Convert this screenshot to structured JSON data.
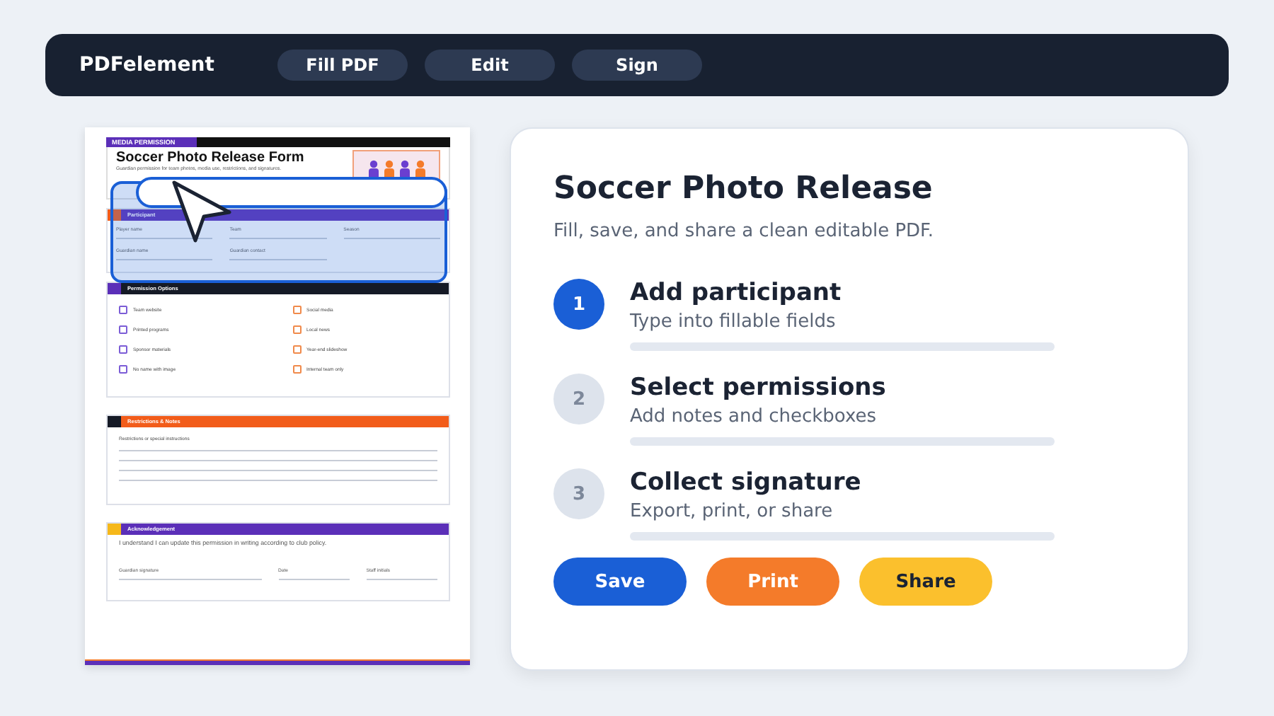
{
  "top_bar": {
    "brand": "PDFelement",
    "nav": [
      "Fill PDF",
      "Edit",
      "Sign"
    ]
  },
  "document": {
    "tag": "MEDIA PERMISSION",
    "title": "Soccer Photo Release Form",
    "subtitle": "Guardian permission for team photos, media use, restrictions, and signatures.",
    "participant": {
      "header": "Participant",
      "fields": [
        {
          "label": "Player name"
        },
        {
          "label": "Team"
        },
        {
          "label": "Season"
        },
        {
          "label": "Guardian name"
        },
        {
          "label": "Guardian contact"
        }
      ]
    },
    "permissions": {
      "header": "Permission Options",
      "options": [
        {
          "label": "Team website",
          "color": "#7b5cd6",
          "checked": false
        },
        {
          "label": "Social media",
          "color": "#f08a4b",
          "checked": false
        },
        {
          "label": "Printed programs",
          "color": "#7b5cd6",
          "checked": false
        },
        {
          "label": "Local news",
          "color": "#f08a4b",
          "checked": false
        },
        {
          "label": "Sponsor materials",
          "color": "#7b5cd6",
          "checked": false
        },
        {
          "label": "Year-end slideshow",
          "color": "#f08a4b",
          "checked": false
        },
        {
          "label": "No name with image",
          "color": "#7b5cd6",
          "checked": false
        },
        {
          "label": "Internal team only",
          "color": "#f08a4b",
          "checked": false
        }
      ]
    },
    "restrictions": {
      "header": "Restrictions & Notes",
      "label": "Restrictions or special instructions"
    },
    "acknowledgement": {
      "header": "Acknowledgement",
      "note": "I understand I can update this permission in writing according to club policy.",
      "fields": [
        {
          "label": "Guardian signature"
        },
        {
          "label": "Date"
        },
        {
          "label": "Staff initials"
        }
      ]
    }
  },
  "panel": {
    "title": "Soccer Photo Release",
    "subtitle": "Fill, save, and share a clean editable PDF.",
    "steps": [
      {
        "number": "1",
        "title": "Add participant",
        "subtitle": "Type into fillable fields",
        "selected": true
      },
      {
        "number": "2",
        "title": "Select permissions",
        "subtitle": "Add notes and checkboxes",
        "selected": false
      },
      {
        "number": "3",
        "title": "Collect signature",
        "subtitle": "Export, print, or share",
        "selected": false
      }
    ],
    "buttons": [
      {
        "label": "Save",
        "color": "#1a5fd6"
      },
      {
        "label": "Print",
        "color": "#f47b2a"
      },
      {
        "label": "Share",
        "color": "#fbc02d"
      }
    ]
  }
}
